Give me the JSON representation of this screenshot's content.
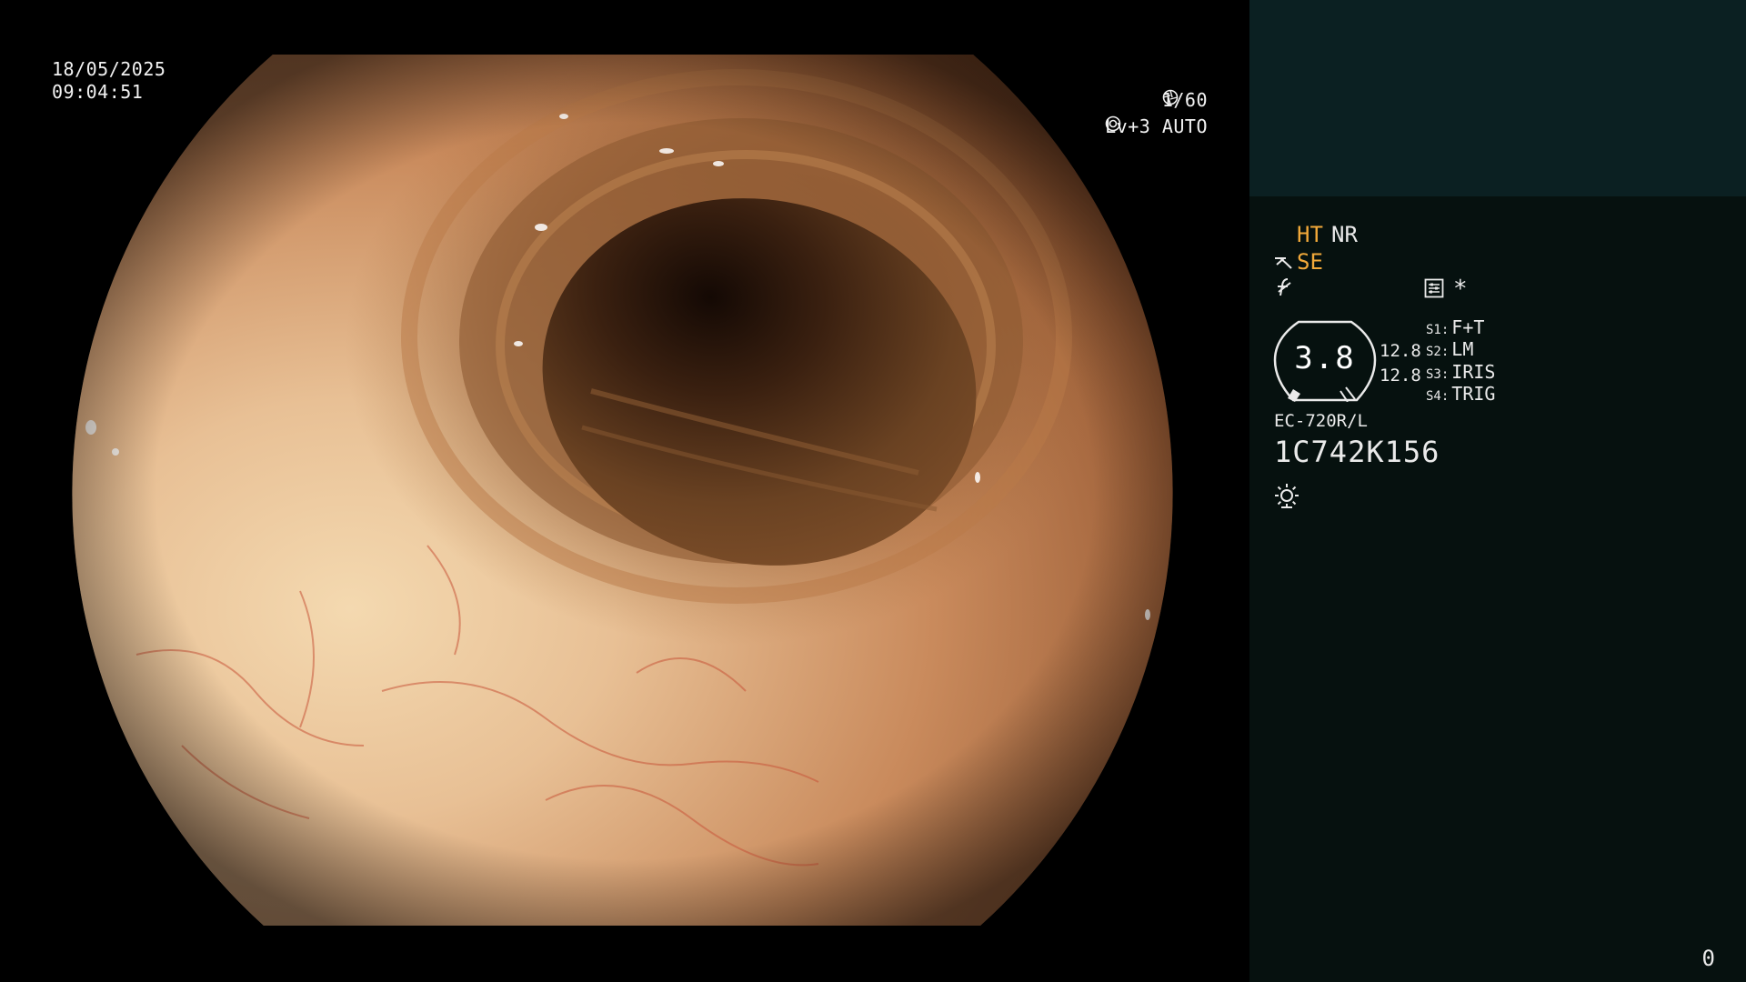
{
  "view": {
    "date": "18/05/2025",
    "time": "09:04:51",
    "shutter": "1/60",
    "shutter_icon": "aperture-icon",
    "level": "Lv+3 AUTO",
    "level_icon": "auto-iris-icon"
  },
  "panel": {
    "ht_label": "HT",
    "nr_label": "NR",
    "se_label": "SE",
    "se_icon": "scope-enhance-icon",
    "f_icon": "freeze-icon",
    "settings_icon": "settings-icon",
    "asterisk": "*",
    "scope_value": "3.8",
    "distance_1": "12.8",
    "distance_2": "12.8",
    "switches": [
      {
        "key": "S1:",
        "label": "F+T"
      },
      {
        "key": "S2:",
        "label": "LM"
      },
      {
        "key": "S3:",
        "label": "IRIS"
      },
      {
        "key": "S4:",
        "label": "TRIG"
      }
    ],
    "model": "EC-720R/L",
    "serial": "1C742K156",
    "light_icon": "light-icon",
    "counter": "0"
  },
  "colors": {
    "panel_top": "#0b2022",
    "panel_bg": "#06110f",
    "accent": "#f2a93a"
  }
}
